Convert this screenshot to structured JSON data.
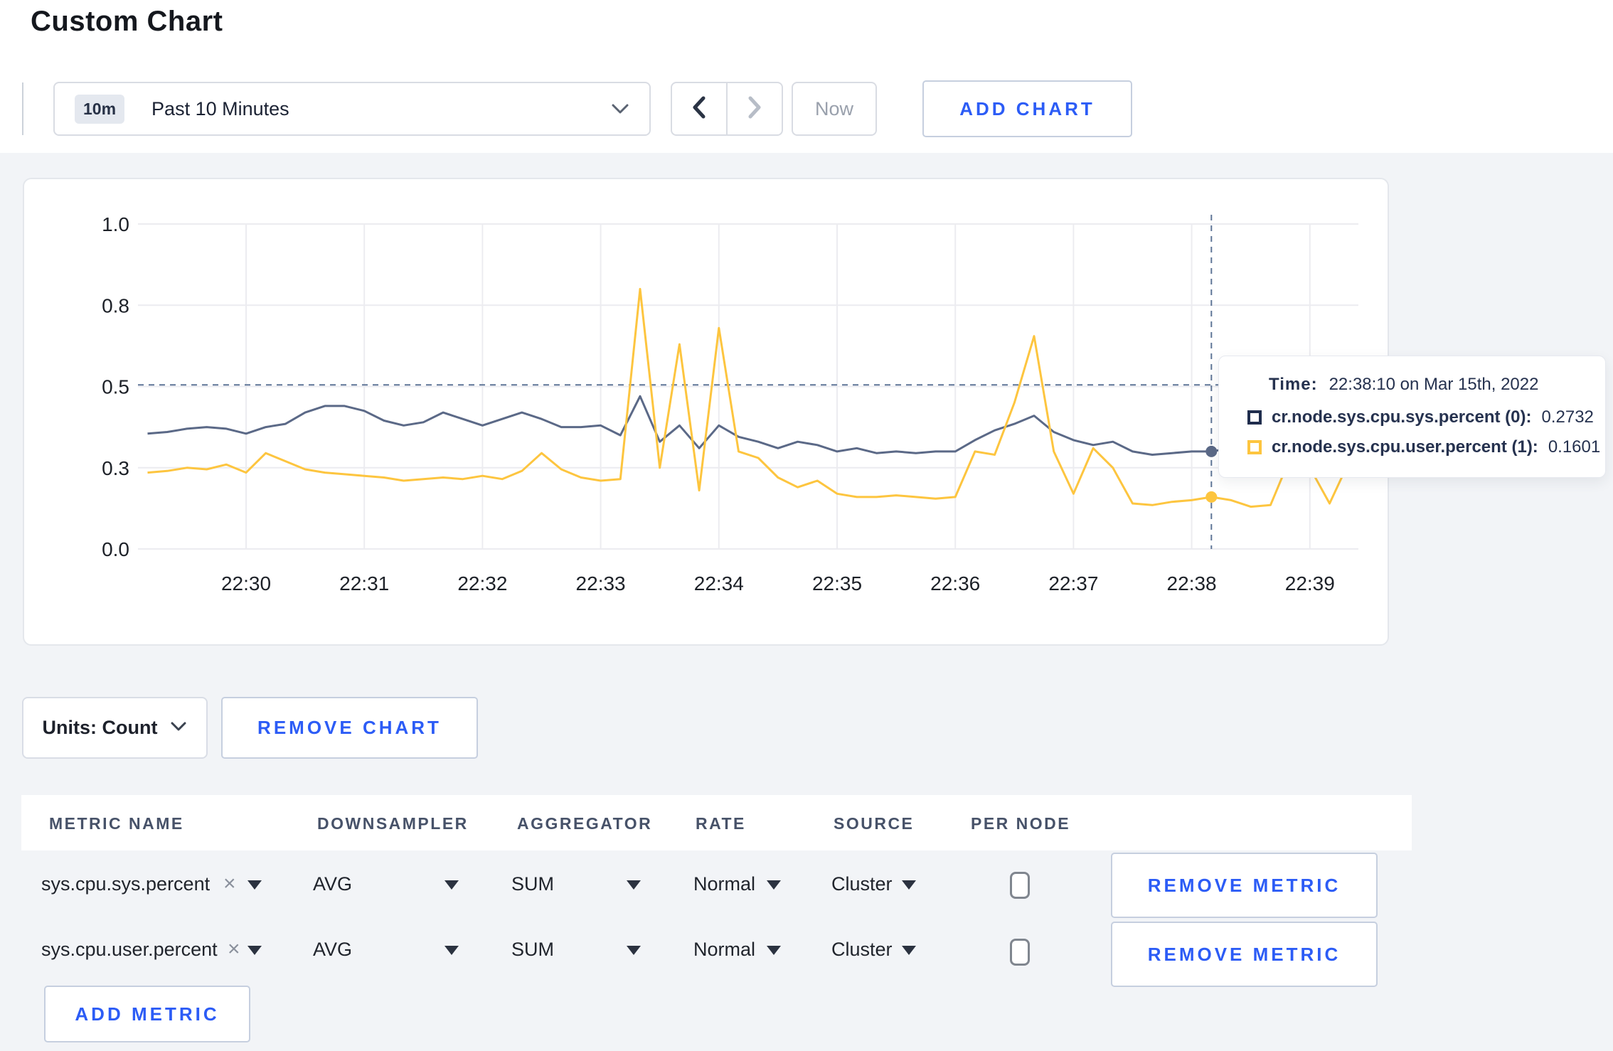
{
  "page": {
    "title": "Custom Chart"
  },
  "colors": {
    "accent_blue": "#2c5cf6",
    "series_sys": "#5b6987",
    "series_user": "#fdc53f",
    "crosshair": "#5f7697",
    "gridline": "#ececf0",
    "page_bg": "#f2f4f7"
  },
  "toolbar": {
    "time_window_badge": "10m",
    "time_window_label": "Past 10 Minutes",
    "now_label": "Now",
    "add_chart_label": "ADD CHART"
  },
  "chart_data": {
    "type": "line",
    "title": "",
    "xlabel": "",
    "ylabel": "",
    "ylim": [
      0.0,
      1.0
    ],
    "grid": true,
    "y_tick_values": [
      0,
      0.25,
      0.5,
      0.75,
      1.0
    ],
    "y_tick_labels": [
      "0.0",
      "0.3",
      "0.5",
      "0.8",
      "1.0"
    ],
    "x_axis_ticks": [
      "22:30",
      "22:31",
      "22:32",
      "22:33",
      "22:34",
      "22:35",
      "22:36",
      "22:37",
      "22:38",
      "22:39"
    ],
    "x_start": "22:29:10",
    "x_step_seconds": 10,
    "series": [
      {
        "name": "cr.node.sys.cpu.sys.percent (0)",
        "color": "#5b6987",
        "values": [
          0.355,
          0.36,
          0.37,
          0.375,
          0.37,
          0.355,
          0.375,
          0.385,
          0.42,
          0.44,
          0.44,
          0.425,
          0.395,
          0.38,
          0.39,
          0.42,
          0.4,
          0.38,
          0.4,
          0.42,
          0.4,
          0.375,
          0.375,
          0.38,
          0.35,
          0.47,
          0.33,
          0.38,
          0.31,
          0.38,
          0.345,
          0.33,
          0.31,
          0.33,
          0.32,
          0.3,
          0.31,
          0.295,
          0.3,
          0.295,
          0.3,
          0.3,
          0.335,
          0.365,
          0.385,
          0.41,
          0.36,
          0.335,
          0.32,
          0.33,
          0.3,
          0.29,
          0.295,
          0.3,
          0.3,
          0.31,
          0.3,
          0.295,
          0.31,
          0.3,
          0.3,
          0.285
        ]
      },
      {
        "name": "cr.node.sys.cpu.user.percent (1)",
        "color": "#fdc53f",
        "values": [
          0.235,
          0.24,
          0.25,
          0.245,
          0.26,
          0.235,
          0.295,
          0.27,
          0.245,
          0.235,
          0.23,
          0.225,
          0.22,
          0.21,
          0.215,
          0.22,
          0.215,
          0.225,
          0.215,
          0.24,
          0.295,
          0.245,
          0.22,
          0.21,
          0.215,
          0.8,
          0.25,
          0.63,
          0.18,
          0.68,
          0.3,
          0.28,
          0.22,
          0.19,
          0.21,
          0.17,
          0.16,
          0.16,
          0.165,
          0.16,
          0.155,
          0.16,
          0.3,
          0.29,
          0.45,
          0.655,
          0.3,
          0.17,
          0.31,
          0.25,
          0.14,
          0.135,
          0.145,
          0.15,
          0.16,
          0.15,
          0.13,
          0.135,
          0.28,
          0.25,
          0.14,
          0.27
        ]
      }
    ],
    "crosshair": {
      "x_index": 54,
      "hline_value": 0.505,
      "hover_values": [
        0.2732,
        0.1601
      ],
      "time": "22:38:10"
    },
    "legend_position": "tooltip"
  },
  "tooltip": {
    "time_label": "Time:",
    "time_value": "22:38:10 on Mar 15th, 2022",
    "rows": [
      {
        "name": "cr.node.sys.cpu.sys.percent (0):",
        "value": "0.2732",
        "swatch_color": "#1f2d4d"
      },
      {
        "name": "cr.node.sys.cpu.user.percent (1):",
        "value": "0.1601",
        "swatch_color": "#fdc53f"
      }
    ]
  },
  "chart_controls": {
    "units_label": "Units: Count",
    "remove_chart_label": "REMOVE CHART"
  },
  "metrics_table": {
    "headers": [
      "METRIC NAME",
      "DOWNSAMPLER",
      "AGGREGATOR",
      "RATE",
      "SOURCE",
      "PER NODE"
    ],
    "rows": [
      {
        "metric_name": "sys.cpu.sys.percent",
        "clear_icon": "×",
        "downsampler": "AVG",
        "aggregator": "SUM",
        "rate": "Normal",
        "source": "Cluster",
        "per_node_checked": false,
        "remove_label": "REMOVE METRIC"
      },
      {
        "metric_name": "sys.cpu.user.percent",
        "clear_icon": "×",
        "downsampler": "AVG",
        "aggregator": "SUM",
        "rate": "Normal",
        "source": "Cluster",
        "per_node_checked": false,
        "remove_label": "REMOVE METRIC"
      }
    ],
    "add_metric_label": "ADD METRIC"
  }
}
